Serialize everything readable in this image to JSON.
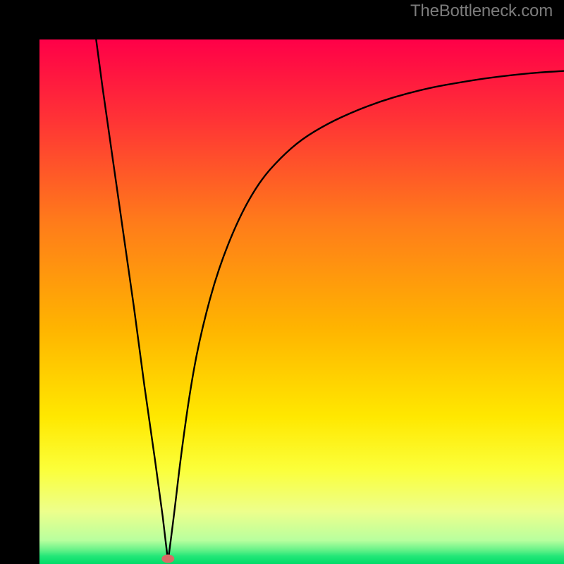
{
  "watermark": "TheBottleneck.com",
  "chart_data": {
    "type": "line",
    "title": "",
    "xlabel": "",
    "ylabel": "",
    "xlim": [
      0,
      100
    ],
    "ylim": [
      0,
      100
    ],
    "grid": false,
    "legend": false,
    "gradient_bands": [
      {
        "pos": 0.0,
        "color": "#ff0048"
      },
      {
        "pos": 0.15,
        "color": "#ff3236"
      },
      {
        "pos": 0.35,
        "color": "#ff7c1a"
      },
      {
        "pos": 0.55,
        "color": "#ffb400"
      },
      {
        "pos": 0.72,
        "color": "#ffe800"
      },
      {
        "pos": 0.82,
        "color": "#fbff3a"
      },
      {
        "pos": 0.9,
        "color": "#edff8c"
      },
      {
        "pos": 0.955,
        "color": "#b8ff9e"
      },
      {
        "pos": 0.972,
        "color": "#6cf38a"
      },
      {
        "pos": 0.985,
        "color": "#23e778"
      },
      {
        "pos": 1.0,
        "color": "#00db68"
      }
    ],
    "dip_x": 24.5,
    "marker": {
      "x": 24.5,
      "y": 1.0,
      "color": "#d96a66"
    },
    "series": [
      {
        "name": "curve",
        "x": [
          10.8,
          12,
          14,
          16,
          18,
          20,
          22,
          23.5,
          24.5,
          25.5,
          27,
          29,
          31,
          34,
          38,
          42,
          46,
          50,
          55,
          60,
          65,
          70,
          75,
          80,
          85,
          90,
          95,
          100
        ],
        "y": [
          100,
          91,
          77,
          63,
          49,
          34,
          20,
          9,
          0.5,
          8,
          21,
          35,
          45,
          56,
          66,
          73,
          77.5,
          81,
          84,
          86.3,
          88.2,
          89.7,
          90.9,
          91.8,
          92.6,
          93.2,
          93.7,
          94
        ]
      }
    ]
  }
}
